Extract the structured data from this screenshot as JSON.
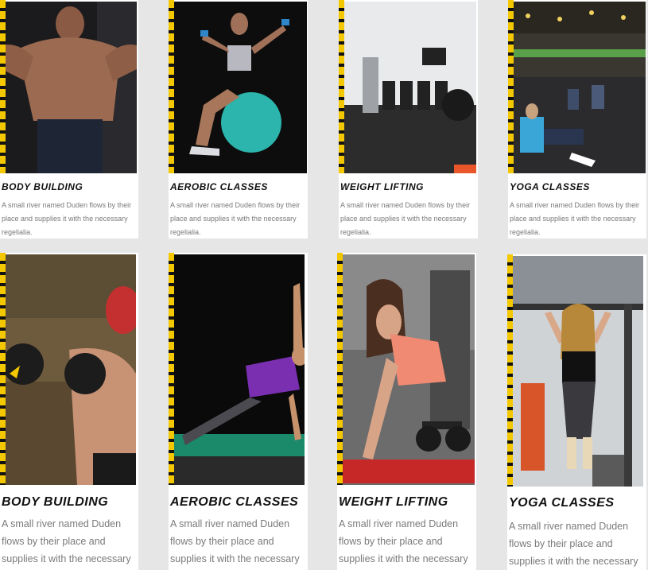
{
  "cards": [
    {
      "title": "BODY BUILDING",
      "text": "A small river named Duden flows by their place and supplies it with the necessary regelialia.",
      "photo": "bodybuilder-photo"
    },
    {
      "title": "AEROBIC CLASSES",
      "text": "A small river named Duden flows by their place and supplies it with the necessary regelialia.",
      "photo": "aerobic-ball-photo"
    },
    {
      "title": "WEIGHT LIFTING",
      "text": "A small river named Duden flows by their place and supplies it with the necessary regelialia.",
      "photo": "gym-room-photo"
    },
    {
      "title": "YOGA CLASSES",
      "text": "A small river named Duden flows by their place and supplies it with the necessary regelialia.",
      "photo": "yoga-class-photo"
    },
    {
      "title": "BODY BUILDING",
      "text": "A small river named Duden flows by their place and supplies it with the necessary regelialia.",
      "photo": "boxer-photo"
    },
    {
      "title": "AEROBIC CLASSES",
      "text": "A small river named Duden flows by their place and supplies it with the necessary regelialia.",
      "photo": "side-plank-photo"
    },
    {
      "title": "WEIGHT LIFTING",
      "text": "A small river named Duden flows by their place and supplies it with the necessary regelialia.",
      "photo": "dumbbell-row-photo"
    },
    {
      "title": "YOGA CLASSES",
      "text": "A small river named Duden flows by their place and supplies it with the necessary regelialia.",
      "photo": "pull-up-photo"
    }
  ],
  "colors": {
    "stripe_yellow": "#f3c800",
    "stripe_black": "#111111",
    "card_bg": "#ffffff",
    "page_bg": "#e6e6e6",
    "text_gray": "#7a7a7a"
  }
}
